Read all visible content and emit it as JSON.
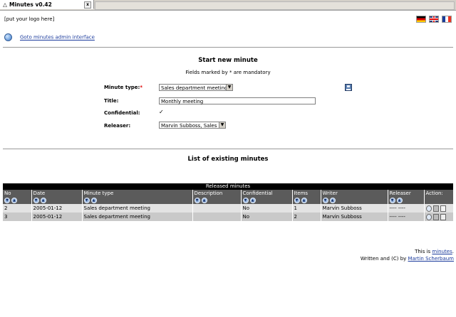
{
  "tab": {
    "title": "Minutes v0.42",
    "close_label": "x"
  },
  "header": {
    "logo_text": "[put your logo here]",
    "languages": [
      "German",
      "English",
      "French"
    ],
    "admin_link": "Goto minutes admin interface"
  },
  "form": {
    "title": "Start new minute",
    "mandatory_note": "Fields marked by * are mandatory",
    "minute_type_label": "Minute type:",
    "minute_type_required": "*",
    "minute_type_value": "Sales department meeting",
    "title_label": "Title:",
    "title_value": "Monthly meeting",
    "confidential_label": "Confidential:",
    "confidential_checked": true,
    "releaser_label": "Releaser:",
    "releaser_value": "Marvin Subboss, Sales"
  },
  "list": {
    "title": "List of existing minutes",
    "caption": "Released minutes",
    "columns": [
      "No",
      "Date",
      "Minute type",
      "Description",
      "Confidential",
      "Items",
      "Writer",
      "Releaser",
      "Action:"
    ],
    "rows": [
      {
        "no": "2",
        "date": "2005-01-12",
        "type": "Sales department meeting",
        "description": "",
        "confidential": "No",
        "items": "1",
        "writer": "Marvin Subboss",
        "releaser": "---- ----"
      },
      {
        "no": "3",
        "date": "2005-01-12",
        "type": "Sales department meeting",
        "description": "",
        "confidential": "No",
        "items": "2",
        "writer": "Marvin Subboss",
        "releaser": "---- ----"
      }
    ]
  },
  "footer": {
    "line1_prefix": "This is",
    "line1_link": "minutes",
    "line1_suffix": ".",
    "line2_prefix": "Written and (C) by",
    "line2_link": "Martin Scherbaum"
  }
}
